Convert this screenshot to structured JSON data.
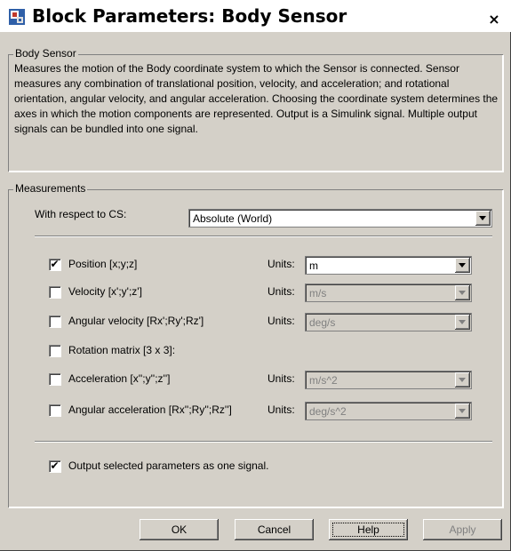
{
  "window": {
    "title": "Block Parameters: Body Sensor",
    "close_glyph": "×"
  },
  "description_group": {
    "legend": "Body Sensor",
    "text": "Measures the motion of the Body coordinate system to which the Sensor is connected. Sensor measures any combination of translational position, velocity, and acceleration; and rotational orientation, angular velocity, and angular acceleration. Choosing the coordinate system determines the axes in which the motion components are represented. Output is a Simulink signal. Multiple output signals can be bundled into one signal."
  },
  "measurements": {
    "legend": "Measurements",
    "cs_label": "With respect to CS:",
    "cs_value": "Absolute (World)",
    "units_label": "Units:",
    "items": [
      {
        "label": "Position [x;y;z]",
        "checked": true,
        "units": "m",
        "units_enabled": true
      },
      {
        "label": "Velocity [x';y';z']",
        "checked": false,
        "units": "m/s",
        "units_enabled": false
      },
      {
        "label": "Angular velocity [Rx';Ry';Rz']",
        "checked": false,
        "units": "deg/s",
        "units_enabled": false
      },
      {
        "label": "Rotation matrix [3 x 3]:",
        "checked": false
      },
      {
        "label": "Acceleration [x'';y'';z'']",
        "checked": false,
        "units": "m/s^2",
        "units_enabled": false
      },
      {
        "label": "Angular acceleration [Rx'';Ry'';Rz'']",
        "checked": false,
        "units": "deg/s^2",
        "units_enabled": false
      }
    ],
    "output_one_signal": {
      "label": "Output selected parameters as one signal.",
      "checked": true
    }
  },
  "buttons": {
    "ok": "OK",
    "cancel": "Cancel",
    "help": "Help",
    "apply": "Apply"
  },
  "icons": {
    "app_icon": "simulink-block-icon",
    "check_glyph": "✔"
  },
  "colors": {
    "face": "#d4d0c8",
    "title_bg": "#ffffff",
    "disabled_text": "#808080"
  }
}
